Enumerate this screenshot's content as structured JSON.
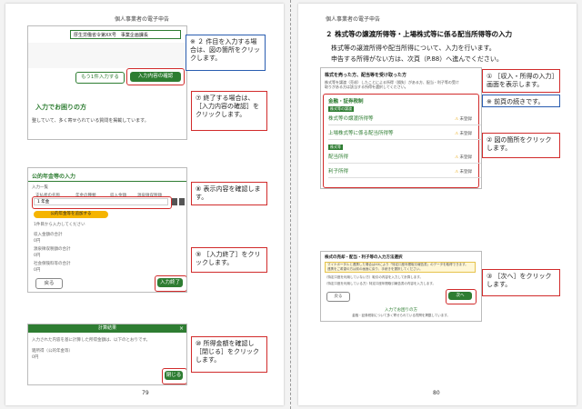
{
  "left": {
    "header": "個人事業者の電子申告",
    "page_number": "79",
    "shot1": {
      "breadcrumb": "税務署 整理番号 事業者 住所",
      "office_bar": "厚生労働省令第XX号　事業企画課長",
      "btn_add": "もう1件入力する",
      "btn_confirm": "入力内容の確認",
      "help_title": "入力でお困りの方",
      "help_text": "整していて、多く寄せられている質問を掲載しています。"
    },
    "callout1": "※ ２ 件目を入力する場合は、図の箇所をクリックします。",
    "callout7": "⑦ 終了する場合は、［入力内容の確認］をクリックします。",
    "shot2": {
      "title": "公的年金等の入力",
      "tab": "入力一覧",
      "col1": "支払者の名称",
      "col2": "年金の種類",
      "col3": "収入金額",
      "col4": "源泉徴収税額",
      "row1": "1 年金",
      "btn_add": "公的年金等を追加する",
      "note": "1件目から入力してください",
      "total_label1": "収入金額の合計",
      "total_value1": "0円",
      "total_label2": "源泉徴収税額の合計",
      "total_value2": "0円",
      "total_label3": "社会保険料等の合計",
      "total_value3": "0円",
      "btn_back": "戻る",
      "btn_done": "入力終了"
    },
    "callout8": "⑧ 表示内容を確認します。",
    "callout9": "⑨ ［入力終了］をクリックします。",
    "shot3": {
      "title": "計算結果",
      "line1": "入力された内容を基に計算した所得金額は、以下のとおりです。",
      "label": "雑所得（公的年金等）",
      "value": "0円",
      "btn_close": "閉じる"
    },
    "callout10": "⑩ 所得金額を確認し［閉じる］をクリックします。"
  },
  "right": {
    "header": "個人事業者の電子申告",
    "page_number": "80",
    "section_title": "２ 株式等の譲渡所得等・上場株式等に係る配当所得等の入力",
    "intro1": "株式等の譲渡所得や配当所得について、入力を行います。",
    "intro2": "申告する所得がない方は、次頁（P.88）へ進んでください。",
    "shot4": {
      "title": "株式を売った方、配当等を受け取った方",
      "desc": "株式等を譲渡（売却）したことによる所得（損失）がある方、配当・利子等の受け取りがある方は該当する所得を選択してください。",
      "group1": "金融・証券税制",
      "badge1": "株式等の譲渡",
      "item1": "株式等の譲渡所得等",
      "item2": "上場株式等に係る配当所得等",
      "badge2": "株式等",
      "item3": "配当所得",
      "item4": "利子所得",
      "warn": "未登録",
      "btn": "入力する"
    },
    "callout1": "① ［収入・所得の入力］画面を表示します。",
    "callout_note": "※ 前頁の続きです。",
    "callout2": "② 図の箇所をクリックします。",
    "shot5": {
      "title": "株式の売却・配当・利子等の入力方法選択",
      "notice1": "マイナポータルと連携した場合はXXにより「特定口座年間取引報告書」のデータを取得できます。",
      "notice2": "連携をご希望の方は前の画面に戻り、手続きを選択してください。",
      "text1": "（特定口座を利用していない方）取引の内容を入力して計算します。",
      "text2": "（特定口座を利用している方）特定口座年間取引報告書の内容を入力します。",
      "btn_back": "戻る",
      "btn_next": "次へ",
      "help": "入力でお困りの方",
      "help_text": "金融・証券税制について多く寄せられている質問を掲載しています。"
    },
    "callout3": "③ ［次へ］をクリックします。"
  },
  "colors": {
    "accent_green": "#2e7d32",
    "callout_red": "#d12b2b",
    "callout_blue": "#2a5db0"
  }
}
